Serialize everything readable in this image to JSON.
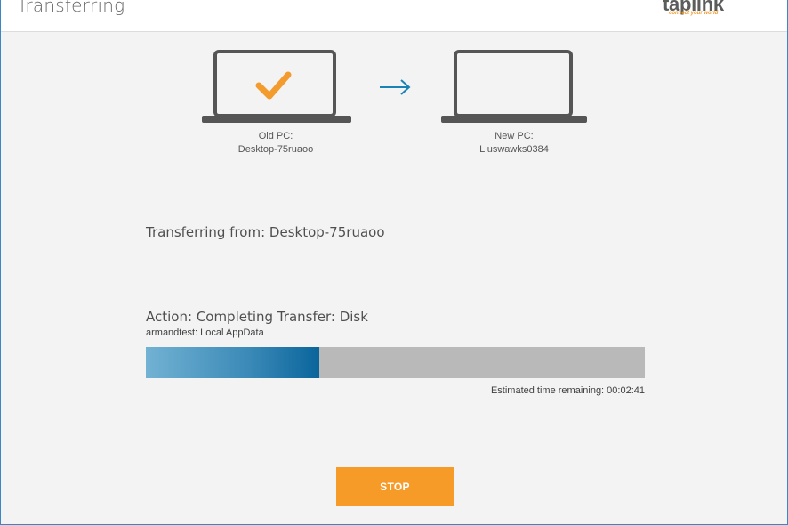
{
  "window": {
    "title": "Transferring"
  },
  "logo": {
    "name": "taplink",
    "tagline": "connect your world"
  },
  "old_pc": {
    "label": "Old PC:",
    "name": "Desktop-75ruaoo",
    "status_icon": "checkmark-icon"
  },
  "new_pc": {
    "label": "New PC:",
    "name": "Lluswawks0384"
  },
  "transfer_from": "Transferring from: Desktop-75ruaoo",
  "action": "Action: Completing Transfer: Disk",
  "subaction": "armandtest: Local AppData",
  "progress": {
    "fraction": 0.347
  },
  "eta": "Estimated time remaining: 00:02:41",
  "stop_label": "STOP",
  "colors": {
    "accent_orange": "#f69b27",
    "progress_blue": "#0a659b",
    "progress_track": "#b9b9b9",
    "arrow_blue": "#1a82b4",
    "laptop_gray": "#555555"
  }
}
